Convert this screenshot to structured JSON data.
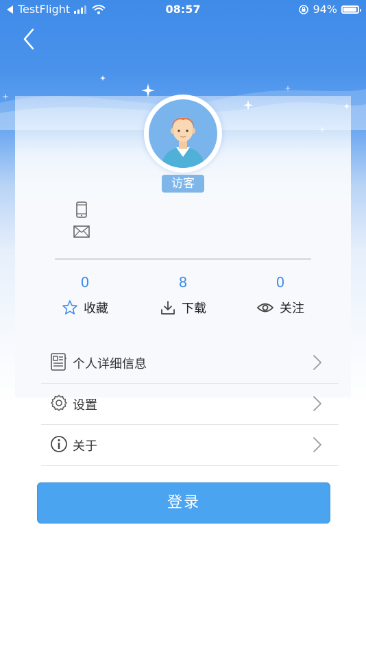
{
  "status_bar": {
    "back_app": "TestFlight",
    "time": "08:57",
    "battery_percent": "94%",
    "battery_level": 0.94
  },
  "header": {
    "back_icon": "chevron-left-icon"
  },
  "profile": {
    "name": "访客",
    "phone_icon": "phone-icon",
    "mail_icon": "mail-icon"
  },
  "stats": [
    {
      "count": "0",
      "label": "收藏",
      "icon": "star-icon"
    },
    {
      "count": "8",
      "label": "下载",
      "icon": "download-icon"
    },
    {
      "count": "0",
      "label": "关注",
      "icon": "eye-icon"
    }
  ],
  "menu": [
    {
      "label": "个人详细信息",
      "icon": "document-icon"
    },
    {
      "label": "设置",
      "icon": "gear-icon"
    },
    {
      "label": "关于",
      "icon": "info-icon"
    }
  ],
  "login_button": "登录",
  "colors": {
    "accent": "#3f8be8",
    "button": "#4aa4ef",
    "badge": "#7fb6ea"
  }
}
